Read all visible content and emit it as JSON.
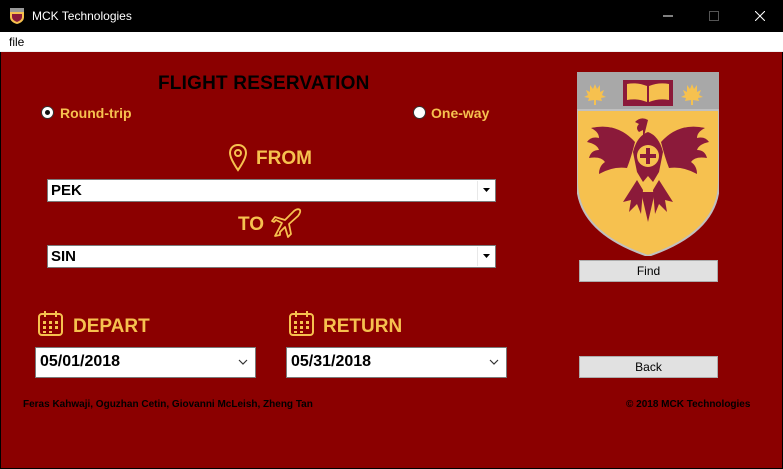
{
  "window": {
    "title": "MCK Technologies"
  },
  "menu": {
    "file": "file"
  },
  "form": {
    "heading": "FLIGHT RESERVATION",
    "trip_round": "Round-trip",
    "trip_oneway": "One-way",
    "trip_selected": "Round-trip",
    "from_label": "FROM",
    "from_value": "PEK",
    "to_label": "TO",
    "to_value": "SIN",
    "depart_label": "DEPART",
    "depart_value": "05/01/2018",
    "return_label": "RETURN",
    "return_value": "05/31/2018"
  },
  "buttons": {
    "find": "Find",
    "back": "Back"
  },
  "footer": {
    "authors": "Feras Kahwaji, Oguzhan Cetin, Giovanni McLeish, Zheng Tan",
    "copyright": "© 2018 MCK Technologies"
  },
  "colors": {
    "background": "#8b0000",
    "accent_gold": "#f6c14f",
    "titlebar": "#000000"
  },
  "icons": {
    "location": "map-pin-icon",
    "plane": "airplane-icon",
    "calendar": "calendar-icon",
    "crest": "university-crest"
  }
}
